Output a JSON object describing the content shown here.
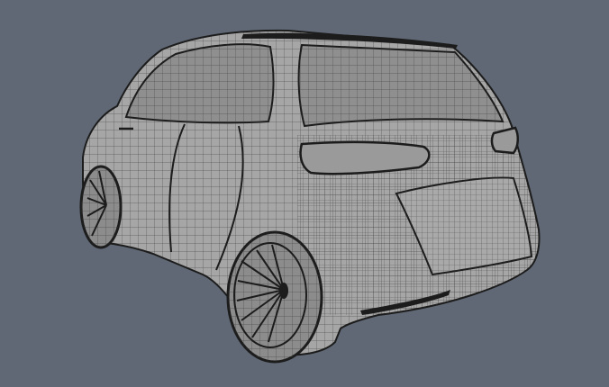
{
  "scene": {
    "background_color": "#5f6874",
    "body_color": "#a6a6a6",
    "glass_color": "#8f8f8f",
    "edge_color": "#1c1c1c",
    "wire_color": "#3a3a3a",
    "subject": "wireframe-car-icon"
  }
}
